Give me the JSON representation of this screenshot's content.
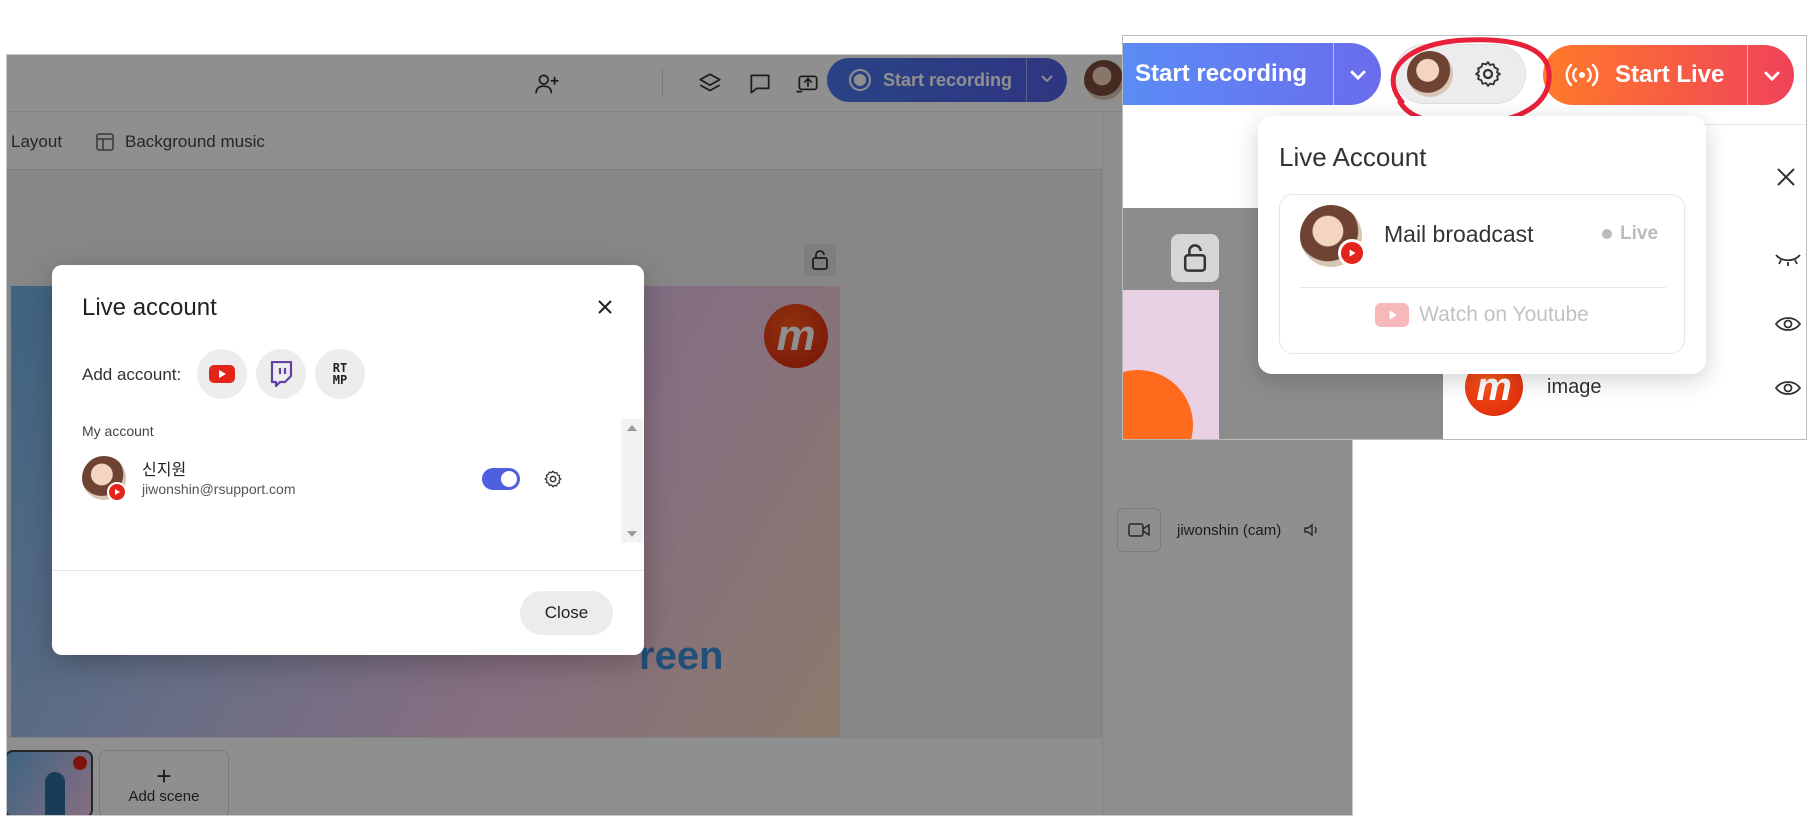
{
  "colors": {
    "record_gradient": [
      "#4a78f0",
      "#5560e6"
    ],
    "live_gradient": [
      "#ff7a2a",
      "#f0425a"
    ],
    "youtube_red": "#e2241b",
    "toggle_on": "#4e5fe0",
    "annotation_red": "#e8203a"
  },
  "app": {
    "toolbar": {
      "icons": [
        "add-user-icon",
        "layers-icon",
        "chat-icon",
        "cast-icon"
      ],
      "record_label": "Start recording"
    },
    "subbar": {
      "layout_label": "Layout",
      "bgm_label": "Background music"
    },
    "stage": {
      "logo_letter": "m",
      "text_fragment": "reen"
    },
    "scenes": {
      "add_scene_label": "Add scene",
      "add_scene_symbol": "+"
    },
    "right_panel": {
      "cam_label": "jiwonshin (cam)"
    }
  },
  "modal": {
    "title": "Live account",
    "add_account_label": "Add account:",
    "rtmp_label": "RT\nMP",
    "my_account_label": "My account",
    "account": {
      "name": "신지원",
      "email": "jiwonshin@rsupport.com",
      "enabled": true
    },
    "close_label": "Close"
  },
  "inset": {
    "record_label": "Start recording",
    "live_label": "Start Live",
    "popover": {
      "title": "Live Account",
      "account_name": "Mail broadcast",
      "status": "Live",
      "watch_label": "Watch on Youtube"
    },
    "sources": {
      "image_label": "image",
      "logo_letter": "m"
    }
  }
}
